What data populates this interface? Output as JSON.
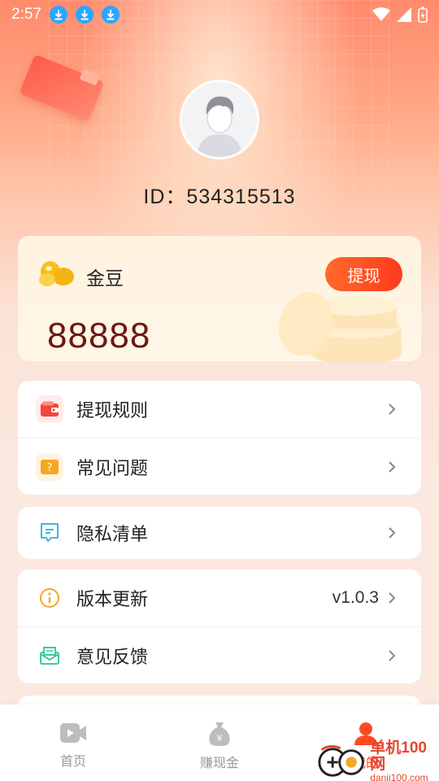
{
  "status_bar": {
    "time": "2:57",
    "download_icons": [
      "download-icon",
      "download-icon",
      "download-icon"
    ],
    "right_icons": [
      "wifi-icon",
      "signal-icon",
      "battery-charging-icon"
    ]
  },
  "profile": {
    "avatar_icon": "default-avatar",
    "id_text": "ID：534315513"
  },
  "coin_card": {
    "label": "金豆",
    "withdraw_label": "提现",
    "amount": "88888"
  },
  "menu": {
    "group1": [
      {
        "label": "提现规则",
        "icon": "wallet-icon",
        "icon_color": "#f0473a"
      },
      {
        "label": "常见问题",
        "icon": "question-icon",
        "icon_color": "#f5a623"
      }
    ],
    "group2": [
      {
        "label": "隐私清单",
        "icon": "document-list-icon",
        "icon_color": "#3cb6e6"
      }
    ],
    "group3": [
      {
        "label": "版本更新",
        "icon": "info-icon",
        "icon_color": "#f5a623",
        "value": "v1.0.3"
      },
      {
        "label": "意见反馈",
        "icon": "feedback-icon",
        "icon_color": "#3cc9a0"
      }
    ]
  },
  "bottom_nav": {
    "tabs": [
      {
        "label": "首页",
        "icon": "video-icon",
        "active": false
      },
      {
        "label": "赚现金",
        "icon": "money-bag-icon",
        "active": false
      },
      {
        "label": "我的",
        "icon": "person-icon",
        "active": true
      }
    ],
    "accent": "#ff4a22"
  },
  "watermark": {
    "title": "单机100网",
    "url": "danji100.com"
  }
}
